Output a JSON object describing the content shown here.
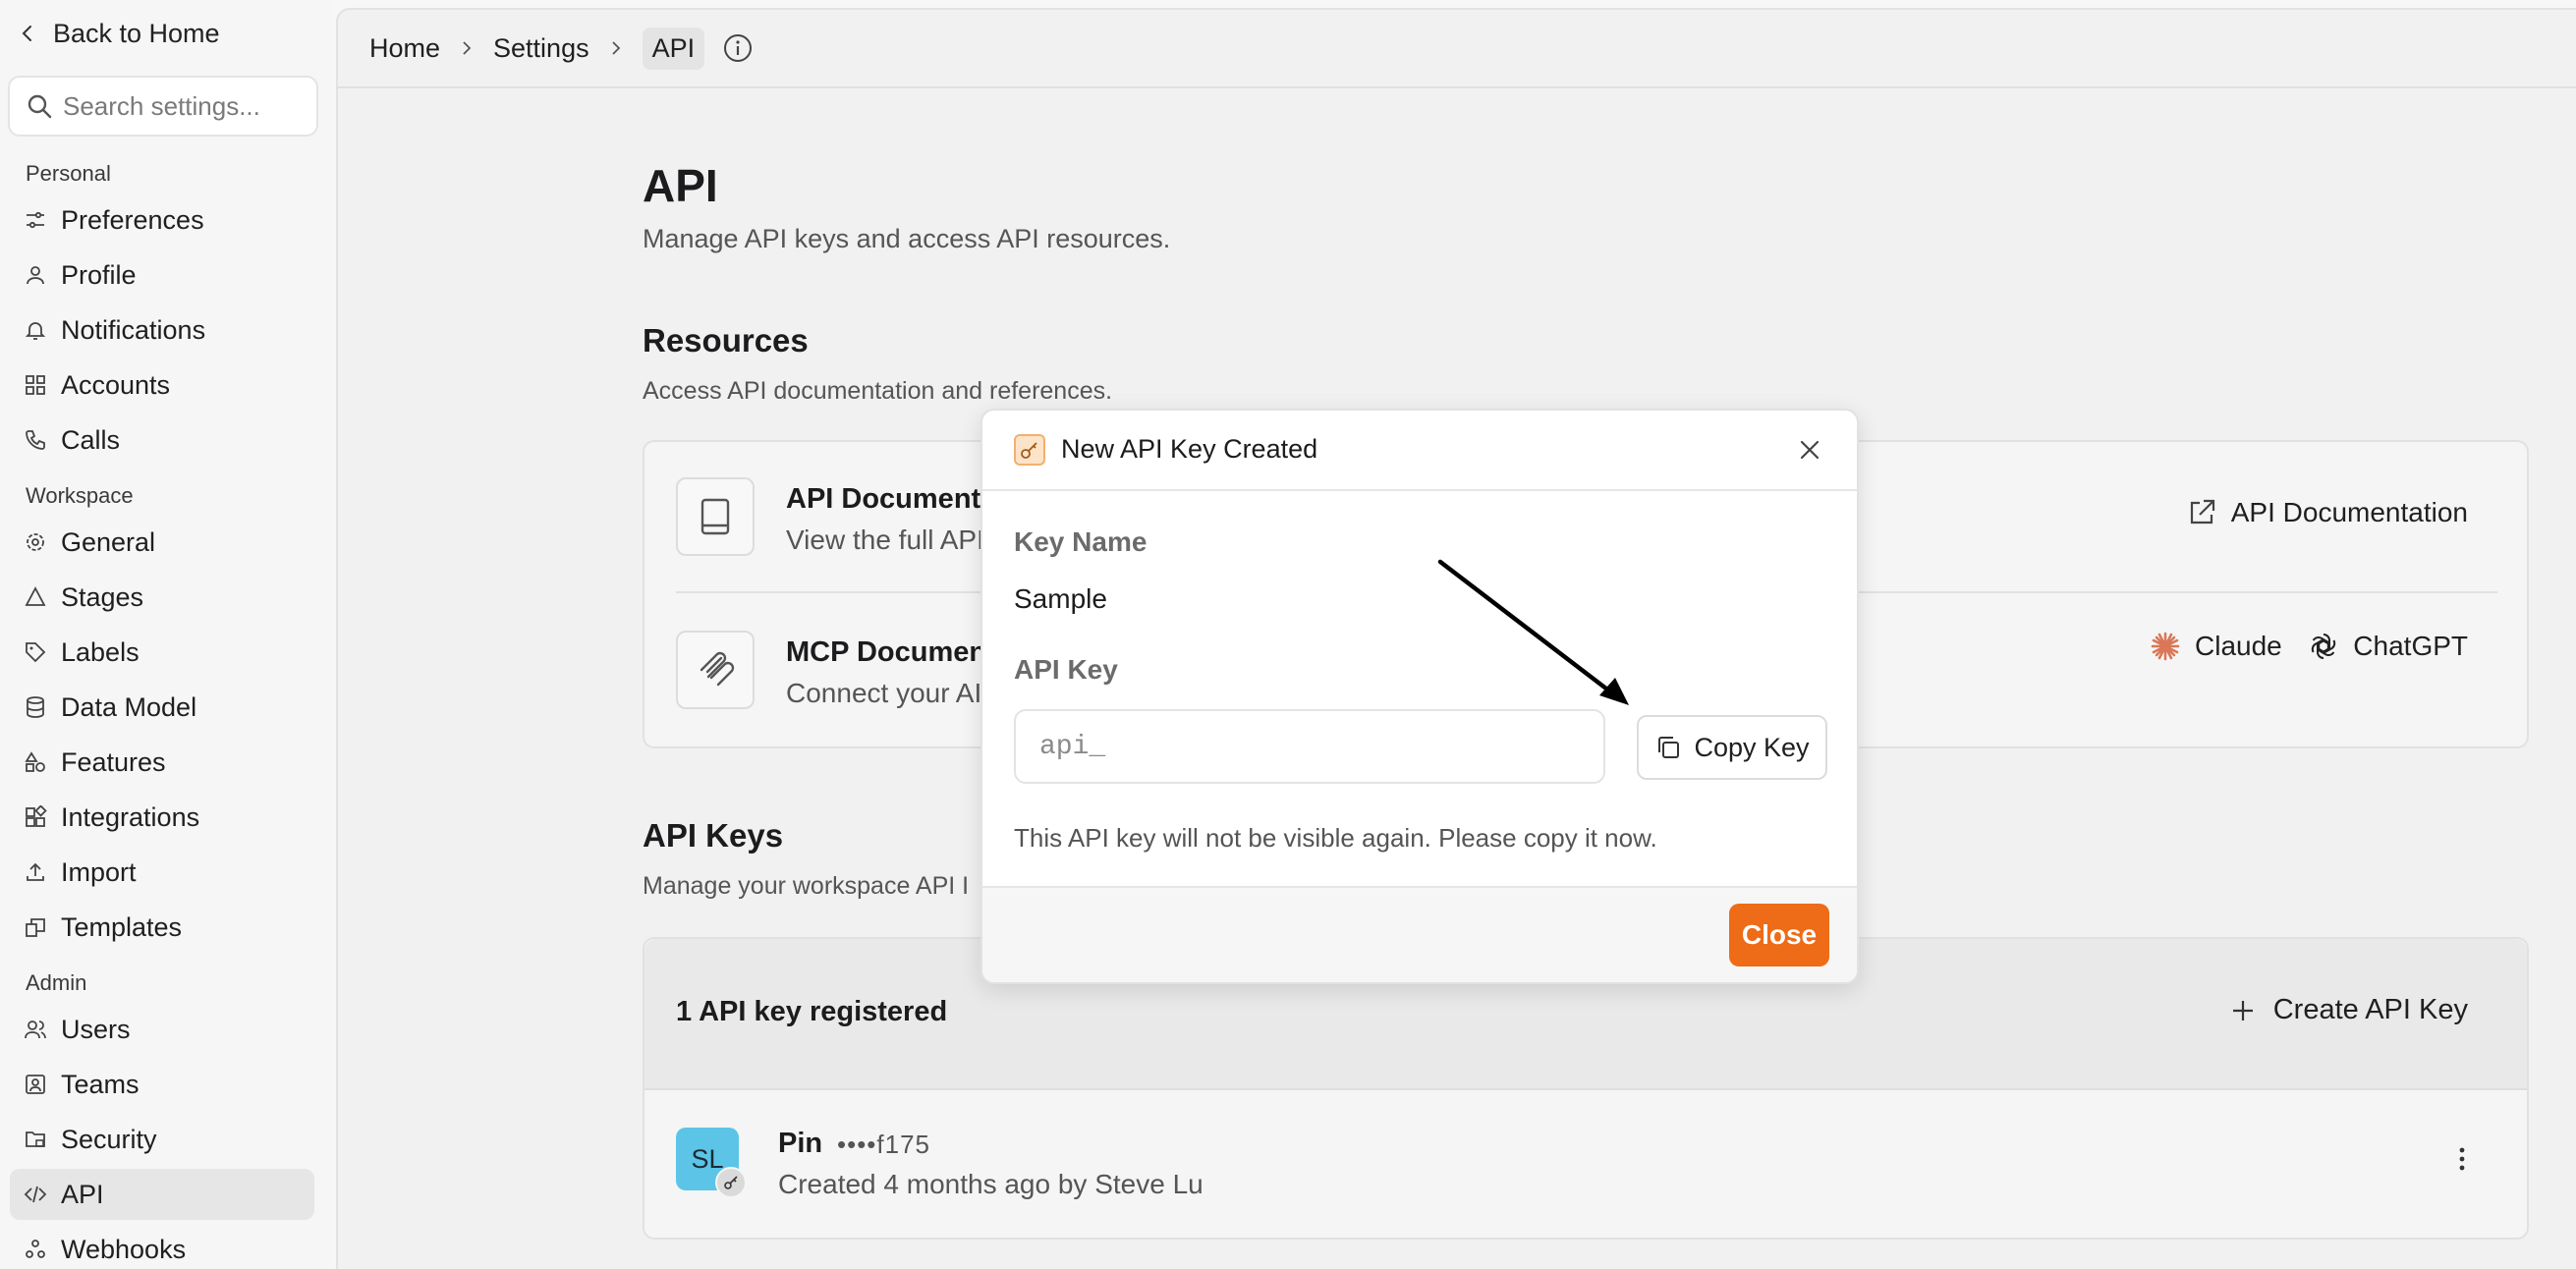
{
  "sidebar": {
    "back_label": "Back to Home",
    "search_placeholder": "Search settings...",
    "sections": {
      "personal": "Personal",
      "workspace": "Workspace",
      "admin": "Admin"
    },
    "personal_items": [
      {
        "label": "Preferences",
        "icon": "sliders-icon"
      },
      {
        "label": "Profile",
        "icon": "user-icon"
      },
      {
        "label": "Notifications",
        "icon": "bell-icon"
      },
      {
        "label": "Accounts",
        "icon": "grid-icon"
      },
      {
        "label": "Calls",
        "icon": "phone-icon"
      }
    ],
    "workspace_items": [
      {
        "label": "General",
        "icon": "gear-icon"
      },
      {
        "label": "Stages",
        "icon": "triangle-icon"
      },
      {
        "label": "Labels",
        "icon": "tag-icon"
      },
      {
        "label": "Data Model",
        "icon": "database-icon"
      },
      {
        "label": "Features",
        "icon": "shapes-icon"
      },
      {
        "label": "Integrations",
        "icon": "puzzle-icon"
      },
      {
        "label": "Import",
        "icon": "upload-icon"
      },
      {
        "label": "Templates",
        "icon": "template-icon"
      }
    ],
    "admin_items": [
      {
        "label": "Users",
        "icon": "users-icon"
      },
      {
        "label": "Teams",
        "icon": "team-icon"
      },
      {
        "label": "Security",
        "icon": "folder-lock-icon"
      },
      {
        "label": "API",
        "icon": "code-icon",
        "active": true
      },
      {
        "label": "Webhooks",
        "icon": "webhook-icon"
      }
    ]
  },
  "breadcrumb": [
    "Home",
    "Settings",
    "API"
  ],
  "page": {
    "title": "API",
    "subtitle": "Manage API keys and access API resources."
  },
  "resources": {
    "title": "Resources",
    "subtitle": "Access API documentation and references.",
    "rows": [
      {
        "title": "API Documenta",
        "desc": "View the full API",
        "icon": "book-icon",
        "links": [
          {
            "label": "API Documentation",
            "icon": "external-link-icon"
          }
        ]
      },
      {
        "title": "MCP Documen",
        "desc": "Connect your AI",
        "icon": "mcp-icon",
        "links": [
          {
            "label": "Claude",
            "icon": "claude-icon"
          },
          {
            "label": "ChatGPT",
            "icon": "chatgpt-icon"
          }
        ]
      }
    ]
  },
  "api_keys": {
    "title": "API Keys",
    "subtitle": "Manage your workspace API I",
    "count_label": "1 API key registered",
    "create_label": "Create API Key",
    "items": [
      {
        "avatar": "SL",
        "name": "Pin",
        "masked": "••••f175",
        "meta": "Created 4 months ago by Steve Lu"
      }
    ]
  },
  "modal": {
    "title": "New API Key Created",
    "key_name_label": "Key Name",
    "key_name_value": "Sample",
    "api_key_label": "API Key",
    "api_key_value": "api_",
    "copy_label": "Copy Key",
    "note": "This API key will not be visible again. Please copy it now.",
    "close_label": "Close"
  },
  "colors": {
    "accent": "#ee6b17",
    "avatar": "#5bc4e7",
    "claude": "#d97757"
  }
}
